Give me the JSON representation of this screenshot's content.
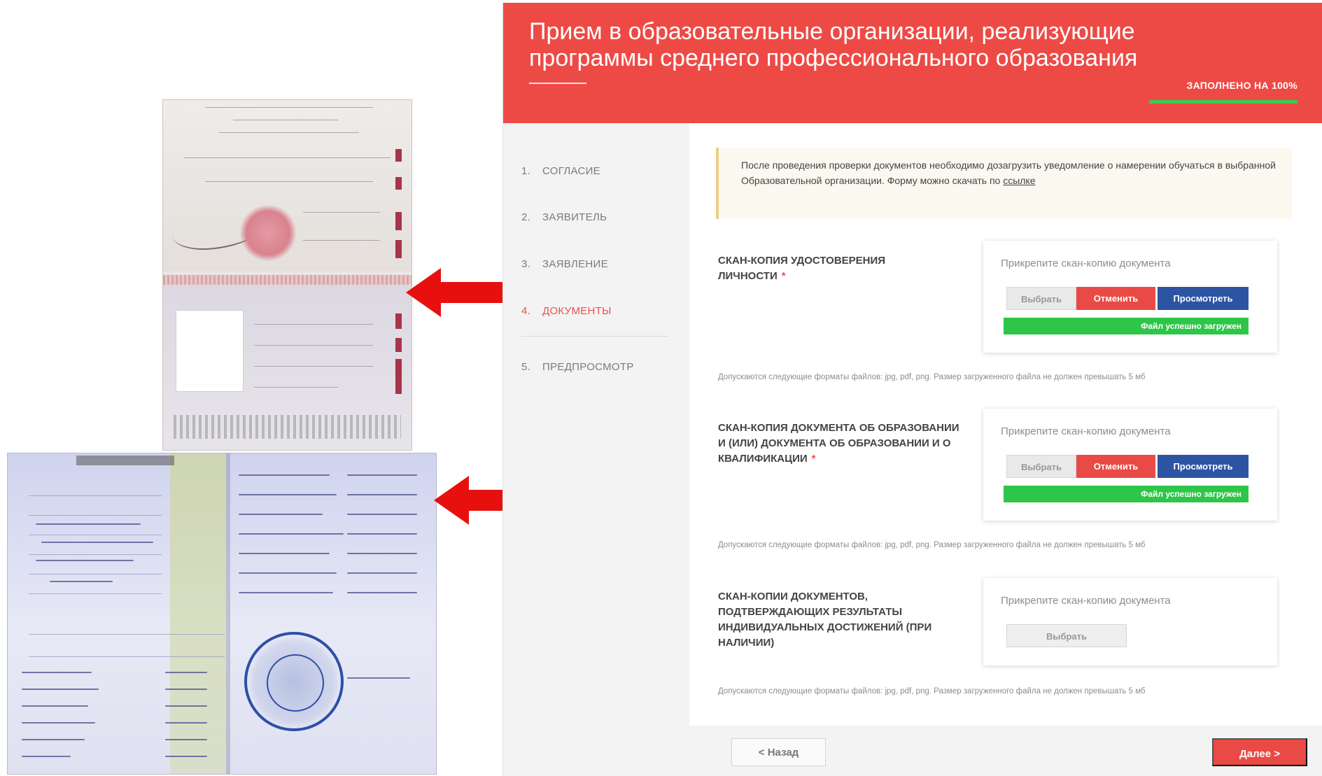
{
  "header": {
    "title": "Прием в образовательные организации, реализующие программы среднего профессионального образования",
    "progress_label": "ЗАПОЛНЕНО НА 100%",
    "progress_value": 1.0,
    "accent_color": "#ee4a45"
  },
  "steps": [
    {
      "num": "1.",
      "label": "СОГЛАСИЕ",
      "active": false
    },
    {
      "num": "2.",
      "label": "ЗАЯВИТЕЛЬ",
      "active": false
    },
    {
      "num": "3.",
      "label": "ЗАЯВЛЕНИЕ",
      "active": false
    },
    {
      "num": "4.",
      "label": "ДОКУМЕНТЫ",
      "active": true
    },
    {
      "num": "5.",
      "label": "ПРЕДПРОСМОТР",
      "active": false
    }
  ],
  "notice": {
    "text": "После проведения проверки документов необходимо дозагрузить уведомление о намерении обучаться в выбранной Образовательной организации. Форму можно скачать по",
    "link_text": "ссылке"
  },
  "documents": [
    {
      "label": "Скан-копия удостоверения личности",
      "required_mark": "*",
      "hint": "Прикрепите скан-копию документа",
      "choose": "Выбрать",
      "cancel": "Отменить",
      "view": "Просмотреть",
      "status": "Файл успешно загружен",
      "formats": "Допускаются следующие форматы файлов: jpg, pdf, png. Размер загруженного файла не должен превышать 5 мб"
    },
    {
      "label": "Скан-копия документа об образовании и (или) документа об образовании и о квалификации",
      "required_mark": "*",
      "hint": "Прикрепите скан-копию документа",
      "choose": "Выбрать",
      "cancel": "Отменить",
      "view": "Просмотреть",
      "status": "Файл успешно загружен",
      "formats": "Допускаются следующие форматы файлов: jpg, pdf, png. Размер загруженного файла не должен превышать 5 мб"
    },
    {
      "label": "Скан-копии документов, подтверждающих результаты индивидуальных достижений (при наличии)",
      "hint": "Прикрепите скан-копию документа",
      "choose": "Выбрать",
      "formats": "Допускаются следующие форматы файлов: jpg, pdf, png. Размер загруженного файла не должен превышать 5 мб"
    }
  ],
  "footer": {
    "back": "< Назад",
    "next": "Далее >"
  },
  "icons": [
    "passport-scan-image",
    "certificate-scan-image",
    "double-arrow-icon"
  ],
  "colors": {
    "success": "#2dc648",
    "cancel": "#ea4a45",
    "view": "#2d54a3",
    "arrow": "#e8100f"
  }
}
